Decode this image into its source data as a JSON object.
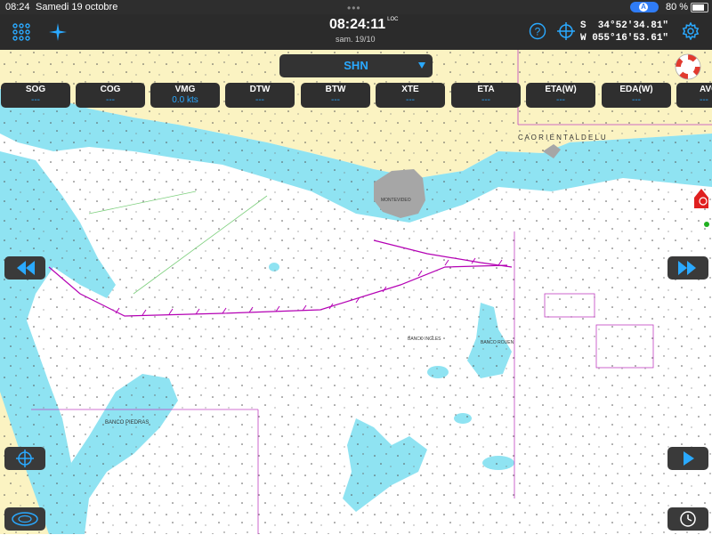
{
  "status_bar": {
    "time": "08:24",
    "date": "Samedi 19 octobre",
    "battery": "80 %",
    "battery_level": 0.8,
    "location_badge": "A"
  },
  "top_bar": {
    "clock_time": "08:24:11",
    "clock_suffix": "LOC",
    "clock_date": "sam. 19/10",
    "latitude": "S  34°52'34.81\"",
    "longitude": "W 055°16'53.61\"",
    "icons": [
      "grid-menu-icon",
      "compass-star-icon",
      "help-icon",
      "crosshair-icon",
      "settings-gear-icon"
    ]
  },
  "route_selector": {
    "value": "SHN"
  },
  "instruments": [
    {
      "label": "SOG",
      "value": "---"
    },
    {
      "label": "COG",
      "value": "---"
    },
    {
      "label": "VMG",
      "value": "0.0 kts"
    },
    {
      "label": "DTW",
      "value": "---"
    },
    {
      "label": "BTW",
      "value": "---"
    },
    {
      "label": "XTE",
      "value": "---"
    },
    {
      "label": "ETA",
      "value": "---"
    },
    {
      "label": "ETA(W)",
      "value": "---"
    },
    {
      "label": "EDA(W)",
      "value": "---"
    },
    {
      "label": "AVG",
      "value": "---"
    }
  ],
  "chart_labels": {
    "coast_name": "C A   O R I E N T A L   D E L   U",
    "city": "MONTEVIDEO",
    "bank_piedras": "BANCO PIEDRAS",
    "bank_ingles": "BANCO INGLES",
    "bank_rouen": "BANCO ROUEN"
  },
  "colors": {
    "bar_bg": "#2b2b2b",
    "accent": "#2aa9ff",
    "land": "#fbf3c2",
    "shallow": "#8fe3f2",
    "deep": "#ffffff",
    "route_magenta": "#b400b4",
    "city": "#a6a6a6"
  }
}
